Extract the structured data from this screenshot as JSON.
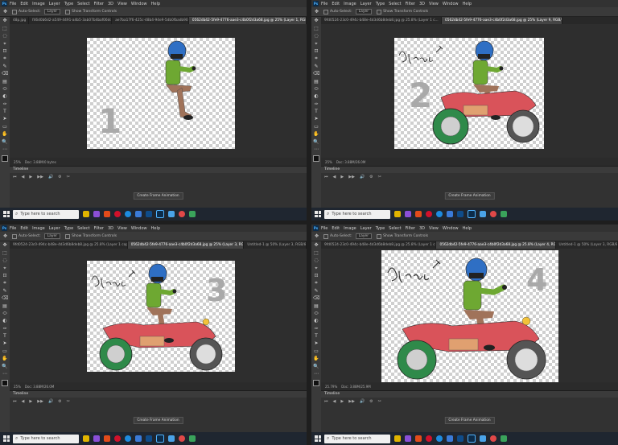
{
  "menu": [
    "File",
    "Edit",
    "Image",
    "Layer",
    "Type",
    "Select",
    "Filter",
    "3D",
    "View",
    "Window",
    "Help"
  ],
  "options_bar": {
    "auto_select": "Auto-Select:",
    "layer_select": "Layer",
    "transform": "Show Transform Controls"
  },
  "timeline": {
    "title": "Timeline",
    "create_button": "Create Frame Animation",
    "controls": [
      "⏮",
      "◀",
      "▶",
      "▶▶",
      "🔊",
      "⚙",
      "✂"
    ]
  },
  "taskbar": {
    "search_placeholder": "Type here to search"
  },
  "tools": [
    "✥",
    "⬚",
    "◌",
    "⌖",
    "⊡",
    "⌗",
    "✎",
    "⌫",
    "▤",
    "⬭",
    "◐",
    "✑",
    "T",
    "➤",
    "▭",
    "✋",
    "🔍",
    "⋯"
  ],
  "colors": {
    "jacket": "#6ea832",
    "helmet": "#2f6fc4",
    "pants": "#a0735a",
    "bike_red": "#d9535a",
    "bike_green": "#2f8a4a",
    "accent": "#4fb3ff"
  },
  "panes": [
    {
      "tabs": [
        "48p.jpg",
        "f46d0b6d2-a549-4491-a4b5-3ab07b4baf06dd.jpg",
        "ae7ba17f6-425c-48b4-94e9-5db0fbadb90.jpg",
        "0562db42-5fe9-4776-aae3-c4b0f2d3a68.jpg @ 25% (Layer 1, RGB/8#) *"
      ],
      "status": [
        "25%",
        "Doc: 3.88M/0 bytes"
      ],
      "frame_number": "1"
    },
    {
      "tabs": [
        "9fd0524-23c0-494c-b48e-4d3d6b8deb8.jpg @ 25.8% (Layer 1 c...",
        "0562db42-5fe9-4776-aae3-c4b0f2d3a68.jpg @ 25% (Layer 9, RGB/8#) *"
      ],
      "status": [
        "25%",
        "Doc: 3.88M/26.0M"
      ],
      "frame_number": "2"
    },
    {
      "tabs": [
        "9fd0524-23c0-494c-b48e-4d3d6b8deb8.jpg @ 25.8% (Layer 1 copy, RG...",
        "0562db42-5fe9-4776-aae3-c4b0f2d3a68.jpg @ 25% (Layer 3, RGB/8#) *",
        "Untitled-1 @ 50% (Layer 3, RGB/8#)"
      ],
      "status": [
        "25%",
        "Doc: 3.88M/26.0M"
      ],
      "frame_number": "3"
    },
    {
      "tabs": [
        "9fd0524-23c0-494c-b48e-4d3d6b8deb8.jpg @ 25.8% (Layer 1 copy, R...",
        "0562db42-5fe9-4776-aae3-c4b0f2d3a68.jpg @ 25.8% (Layer 4, RGB/8#) *",
        "Untitled-1 @ 50% (Layer 3, RGB/8#)"
      ],
      "status": [
        "25.79%",
        "Doc: 3.88M/25.9M"
      ],
      "frame_number": "4"
    }
  ]
}
